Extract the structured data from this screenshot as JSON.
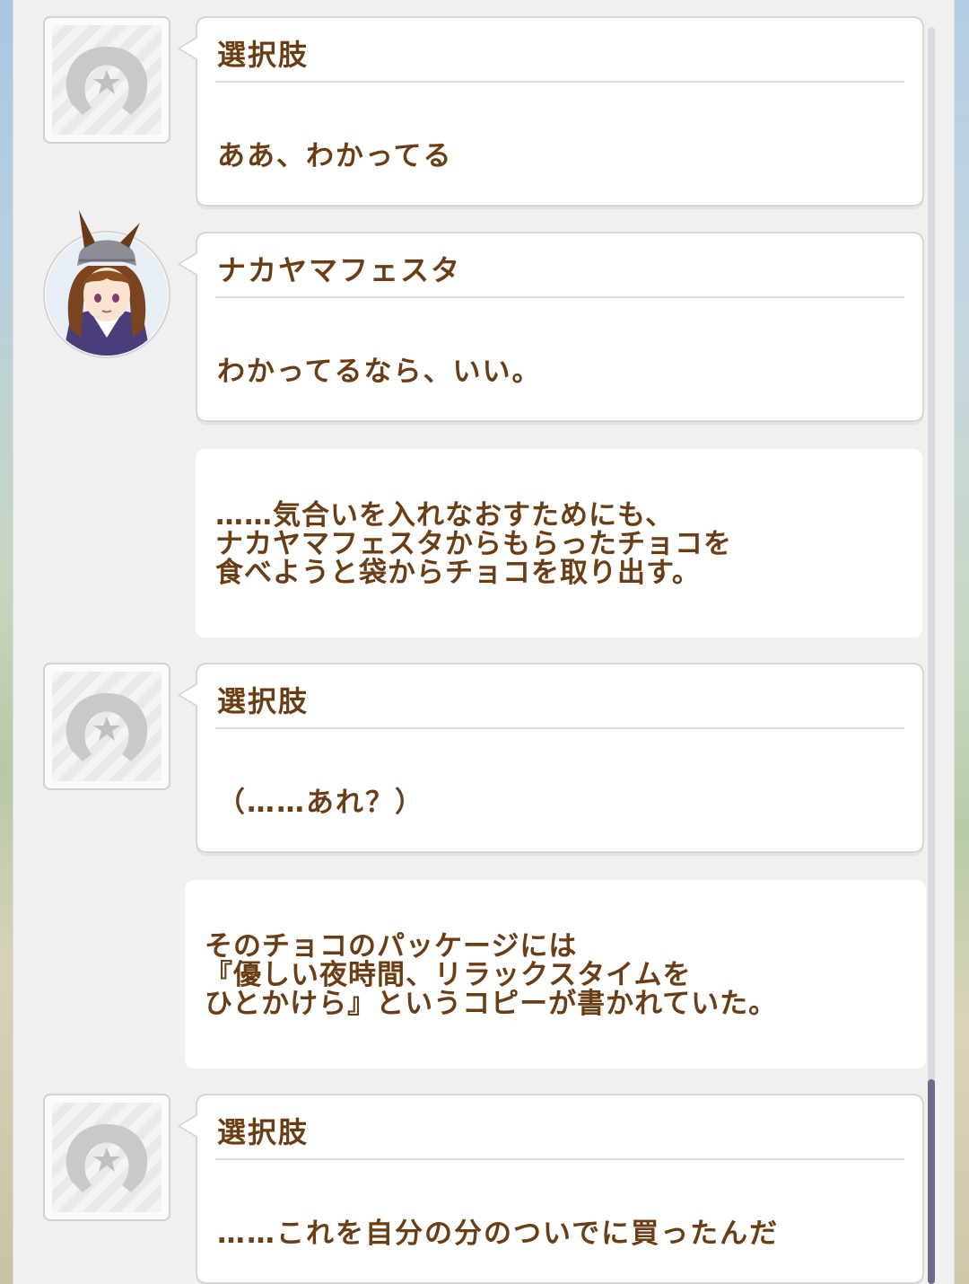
{
  "messages": [
    {
      "speaker": "選択肢",
      "text": "ああ、わかってる",
      "icon": "horseshoe-icon"
    },
    {
      "speaker": "ナカヤマフェスタ",
      "text": "わかってるなら、いい。",
      "icon": "character-avatar"
    },
    {
      "narration": [
        "……気合いを入れなおすためにも、",
        "ナカヤマフェスタからもらったチョコを",
        "食べようと袋からチョコを取り出す。"
      ]
    },
    {
      "speaker": "選択肢",
      "text": "（……あれ？）",
      "icon": "horseshoe-icon"
    },
    {
      "narration": [
        "そのチョコのパッケージには",
        "『優しい夜時間、リラックスタイムを",
        "ひとかけら』というコピーが書かれていた。"
      ]
    },
    {
      "speaker": "選択肢",
      "text": "……これを自分の分のついでに買ったんだ",
      "icon": "horseshoe-icon"
    }
  ],
  "colors": {
    "text": "#6b3d14",
    "bubble": "#ffffff",
    "panel": "#f0f0f0",
    "scroll_thumb": "#6d6a8a"
  },
  "scroll": {
    "position": 1.0
  }
}
